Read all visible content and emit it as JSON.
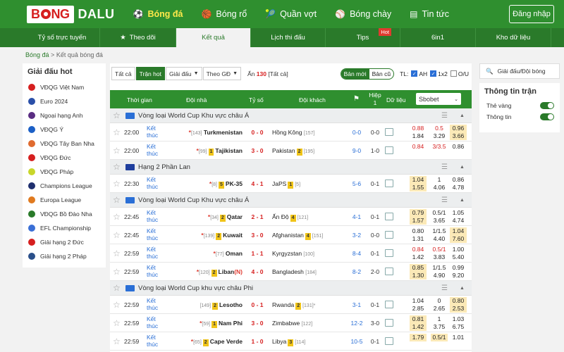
{
  "header": {
    "logo_a": "B",
    "logo_b": "NG",
    "logo_c": "DALU",
    "nav": [
      {
        "label": "Bóng đá",
        "icon": "soccer-ball-icon",
        "active": true
      },
      {
        "label": "Bóng rổ",
        "icon": "basketball-icon",
        "active": false
      },
      {
        "label": "Quần vợt",
        "icon": "tennis-icon",
        "active": false
      },
      {
        "label": "Bóng chày",
        "icon": "baseball-icon",
        "active": false
      },
      {
        "label": "Tin tức",
        "icon": "news-icon",
        "active": false
      }
    ],
    "login": "Đăng nhập"
  },
  "subnav": [
    {
      "label": "Tỷ số trực tuyến"
    },
    {
      "label": "Theo dõi",
      "icon": "star-icon"
    },
    {
      "label": "Kết quả",
      "active": true
    },
    {
      "label": "Lịch thi đấu"
    },
    {
      "label": "Tips",
      "hot": "Hot"
    },
    {
      "label": "6in1"
    },
    {
      "label": "Kho dữ liệu"
    }
  ],
  "breadcrumb": {
    "home": "Bóng đá",
    "sep": ">",
    "current": "Kết quả bóng đá"
  },
  "sidebar": {
    "title": "Giải đấu hot",
    "items": [
      {
        "label": "VĐQG Việt Nam",
        "color": "#d61f1f"
      },
      {
        "label": "Euro 2024",
        "color": "#2a4fa8"
      },
      {
        "label": "Ngoại hạng Anh",
        "color": "#5a2d82"
      },
      {
        "label": "VĐQG Ý",
        "color": "#1b5fc6"
      },
      {
        "label": "VĐQG Tây Ban Nha",
        "color": "#e06b2f"
      },
      {
        "label": "VĐQG Đức",
        "color": "#d61f1f"
      },
      {
        "label": "VĐQG Pháp",
        "color": "#c8d62a"
      },
      {
        "label": "Champions League",
        "color": "#1f2f6e"
      },
      {
        "label": "Europa League",
        "color": "#e07a1f"
      },
      {
        "label": "VĐQG Bồ Đào Nha",
        "color": "#2a7a2a"
      },
      {
        "label": "EFL Championship",
        "color": "#3a6fd6"
      },
      {
        "label": "Giải hạng 2 Đức",
        "color": "#d61f1f"
      },
      {
        "label": "Giải hạng 2 Pháp",
        "color": "#2a4f8a"
      }
    ]
  },
  "filters": {
    "all": "Tất cả",
    "hot": "Trận hot",
    "league": "Giải đấu",
    "gmt": "Theo GĐ",
    "hidden_prefix": "Ẩn",
    "hidden_count": "130",
    "hidden_suffix": "[Tất cả]",
    "new_ver": "Bản mới",
    "old_ver": "Bản cũ",
    "tl_label": "TL:",
    "ah": "AH",
    "x12": "1x2",
    "ou": "O/U"
  },
  "table_head": {
    "time": "Thời gian",
    "home": "Đội nhà",
    "score": "Tỷ số",
    "away": "Đội khách",
    "ht_a": "Hiệp",
    "ht_b": "1",
    "data": "Dữ liệu",
    "bookie": "Sbobet"
  },
  "groups": [
    {
      "league": "Vòng loại World Cup Khu vực châu Á",
      "flag": "#2a6fd6",
      "matches": [
        {
          "time": "22:00",
          "status": "Kết thúc",
          "home_pre": "*",
          "home_rank": "[143]",
          "home": "Turkmenistan",
          "home_card": "",
          "score": "0 - 0",
          "away": "Hồng Kông",
          "away_card": "",
          "away_rank": "[157]",
          "ht": "0-0",
          "corner": "0-0",
          "o1": [
            "0.88",
            "1.84"
          ],
          "o2": [
            "0.5",
            "3.29"
          ],
          "o3": [
            "0.96",
            "3.66"
          ],
          "hl": [
            false,
            false,
            true
          ],
          "red": [
            true,
            true,
            false
          ]
        },
        {
          "time": "22:00",
          "status": "Kết thúc",
          "home_pre": "*",
          "home_rank": "[99]",
          "home": "Tajikistan",
          "home_card": "1",
          "score": "3 - 0",
          "away": "Pakistan",
          "away_card": "2",
          "away_rank": "[195]",
          "ht": "9-0",
          "corner": "1-0",
          "o1": [
            "0.84",
            ""
          ],
          "o2": [
            "3/3.5",
            ""
          ],
          "o3": [
            "0.86",
            ""
          ],
          "hl": [
            false,
            false,
            false
          ],
          "red": [
            true,
            true,
            false
          ]
        }
      ]
    },
    {
      "league": "Hạng 2 Phần Lan",
      "flag": "#1f3f9e",
      "matches": [
        {
          "time": "22:30",
          "status": "Kết thúc",
          "home_pre": "*",
          "home_rank": "[8]",
          "home": "PK-35",
          "home_card": "5",
          "score": "4 - 1",
          "away": "JaPS",
          "away_card": "1",
          "away_rank": "[5]",
          "ht": "5-6",
          "corner": "0-1",
          "o1": [
            "1.04",
            "1.55"
          ],
          "o2": [
            "1",
            "4.06"
          ],
          "o3": [
            "0.86",
            "4.78"
          ],
          "hl": [
            true,
            false,
            false
          ],
          "red": [
            false,
            false,
            false
          ]
        }
      ]
    },
    {
      "league": "Vòng loại World Cup Khu vực châu Á",
      "flag": "#2a6fd6",
      "matches": [
        {
          "time": "22:45",
          "status": "Kết thúc",
          "home_pre": "*",
          "home_rank": "[34]",
          "home": "Qatar",
          "home_card": "2",
          "score": "2 - 1",
          "away": "Ấn Độ",
          "away_card": "4",
          "away_rank": "[121]",
          "ht": "4-1",
          "corner": "0-1",
          "o1": [
            "0.79",
            "1.57"
          ],
          "o2": [
            "0.5/1",
            "3.65"
          ],
          "o3": [
            "1.05",
            "4.74"
          ],
          "hl": [
            true,
            false,
            false
          ],
          "red": [
            false,
            false,
            false
          ]
        },
        {
          "time": "22:45",
          "status": "Kết thúc",
          "home_pre": "*",
          "home_rank": "[139]",
          "home": "Kuwait",
          "home_card": "2",
          "score": "3 - 0",
          "away": "Afghanistan",
          "away_card": "4",
          "away_rank": "[151]",
          "ht": "3-2",
          "corner": "0-0",
          "o1": [
            "0.80",
            "1.31"
          ],
          "o2": [
            "1/1.5",
            "4.40"
          ],
          "o3": [
            "1.04",
            "7.60"
          ],
          "hl": [
            false,
            false,
            true
          ],
          "red": [
            false,
            false,
            false
          ]
        },
        {
          "time": "22:59",
          "status": "Kết thúc",
          "home_pre": "*",
          "home_rank": "[77]",
          "home": "Oman",
          "home_card": "",
          "score": "1 - 1",
          "away": "Kyrgyzstan",
          "away_card": "",
          "away_rank": "[100]",
          "ht": "8-4",
          "corner": "0-1",
          "o1": [
            "0.84",
            "1.42"
          ],
          "o2": [
            "0.5/1",
            "3.83"
          ],
          "o3": [
            "1.00",
            "5.40"
          ],
          "hl": [
            false,
            false,
            false
          ],
          "red": [
            true,
            true,
            false
          ]
        },
        {
          "time": "22:59",
          "status": "Kết thúc",
          "home_pre": "*",
          "home_rank": "[120]",
          "home": "Liban",
          "home_card": "2",
          "home_red": "(N)",
          "score": "4 - 0",
          "away": "Bangladesh",
          "away_card": "",
          "away_rank": "[184]",
          "ht": "8-2",
          "corner": "2-0",
          "o1": [
            "0.85",
            "1.30"
          ],
          "o2": [
            "1/1.5",
            "4.90"
          ],
          "o3": [
            "0.99",
            "9.20"
          ],
          "hl": [
            true,
            false,
            false
          ],
          "red": [
            false,
            false,
            false
          ]
        }
      ]
    },
    {
      "league": "Vòng loại World Cup khu vực châu Phi",
      "flag": "#2a6fd6",
      "matches": [
        {
          "time": "22:59",
          "status": "Kết thúc",
          "home_pre": "",
          "home_rank": "[149]",
          "home": "Lesotho",
          "home_card": "2",
          "score": "0 - 1",
          "away": "Rwanda",
          "away_card": "2",
          "away_rank": "[131]*",
          "ht": "3-1",
          "corner": "0-1",
          "o1": [
            "1.04",
            "2.85"
          ],
          "o2": [
            "0",
            "2.65"
          ],
          "o3": [
            "0.80",
            "2.53"
          ],
          "hl": [
            false,
            false,
            true
          ],
          "red": [
            false,
            false,
            false
          ]
        },
        {
          "time": "22:59",
          "status": "Kết thúc",
          "home_pre": "*",
          "home_rank": "[59]",
          "home": "Nam Phi",
          "home_card": "1",
          "score": "3 - 0",
          "away": "Zimbabwe",
          "away_card": "",
          "away_rank": "[122]",
          "ht": "12-2",
          "corner": "3-0",
          "o1": [
            "0.81",
            "1.42"
          ],
          "o2": [
            "1",
            "3.75"
          ],
          "o3": [
            "1.03",
            "6.75"
          ],
          "hl": [
            true,
            false,
            false
          ],
          "red": [
            false,
            false,
            false
          ]
        },
        {
          "time": "22:59",
          "status": "Kết thúc",
          "home_pre": "*",
          "home_rank": "[65]",
          "home": "Cape Verde",
          "home_card": "2",
          "score": "1 - 0",
          "away": "Libya",
          "away_card": "3",
          "away_rank": "[114]",
          "ht": "10-5",
          "corner": "0-1",
          "o1": [
            "1.79",
            ""
          ],
          "o2": [
            "0.5/1",
            ""
          ],
          "o3": [
            "1.01",
            ""
          ],
          "hl": [
            true,
            true,
            false
          ],
          "red": [
            false,
            false,
            false
          ]
        }
      ]
    }
  ],
  "right": {
    "search_placeholder": "Giải đấu/Đội bóng",
    "info_title": "Thông tin trận",
    "opts": [
      "Thẻ vàng",
      "Thông tin"
    ]
  }
}
